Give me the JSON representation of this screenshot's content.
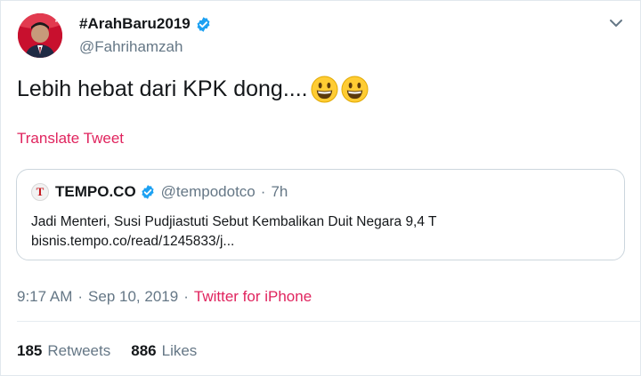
{
  "author": {
    "display_name": "#ArahBaru2019",
    "handle": "@Fahrihamzah",
    "avatar_badge": "4"
  },
  "tweet": {
    "text": "Lebih hebat dari KPK dong....",
    "emojis": [
      "smiley-icon",
      "smiley-icon"
    ],
    "translate_label": "Translate Tweet"
  },
  "quoted": {
    "logo_letter": "T",
    "name": "TEMPO.CO",
    "handle": "@tempodotco",
    "dot": "·",
    "time": "7h",
    "line1": "Jadi Menteri, Susi Pudjiastuti Sebut Kembalikan Duit Negara 9,4 T",
    "line2": "bisnis.tempo.co/read/1245833/j..."
  },
  "meta": {
    "time": "9:17 AM",
    "date": "Sep 10, 2019",
    "separator": "·",
    "source": "Twitter for iPhone"
  },
  "stats": {
    "retweets_count": "185",
    "retweets_label": "Retweets",
    "likes_count": "886",
    "likes_label": "Likes"
  },
  "colors": {
    "accent_link": "#e0245e",
    "verified": "#1da1f2",
    "secondary_text": "#657786",
    "avatar_bg": "#c8102e"
  }
}
